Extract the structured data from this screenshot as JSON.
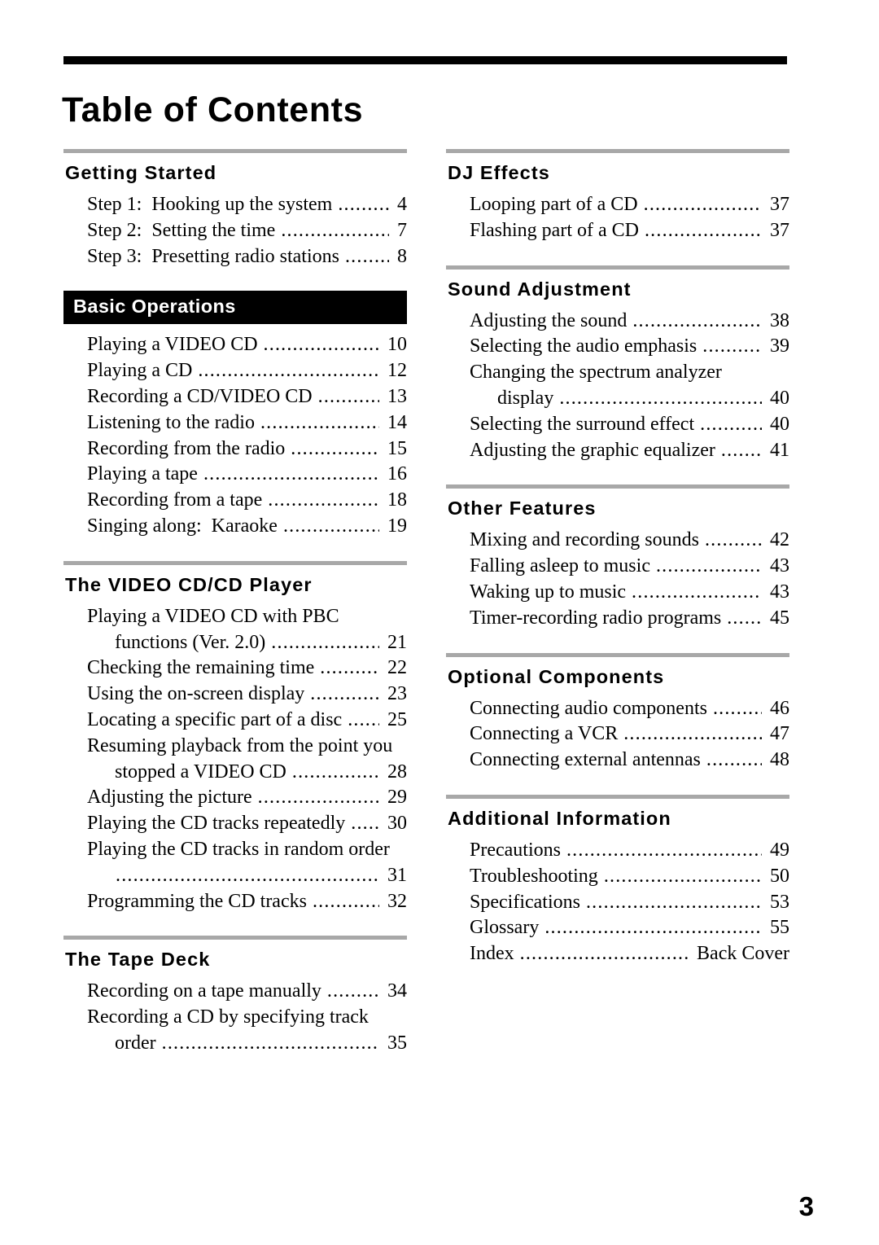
{
  "document": {
    "title": "Table of Contents",
    "folio": "3"
  },
  "columns": [
    {
      "name": "left",
      "sections": [
        {
          "heading": "Getting Started",
          "style": "rule",
          "entries": [
            {
              "lines": [
                "Step 1:  Hooking up the system"
              ],
              "page": "4"
            },
            {
              "lines": [
                "Step 2:  Setting the time"
              ],
              "page": "7"
            },
            {
              "lines": [
                "Step 3:  Presetting radio stations"
              ],
              "page": "8"
            }
          ]
        },
        {
          "heading": "Basic Operations",
          "style": "banner",
          "entries": [
            {
              "lines": [
                "Playing a VIDEO CD"
              ],
              "page": "10"
            },
            {
              "lines": [
                "Playing a CD"
              ],
              "page": "12"
            },
            {
              "lines": [
                "Recording a CD/VIDEO CD"
              ],
              "page": "13"
            },
            {
              "lines": [
                "Listening to the radio"
              ],
              "page": "14"
            },
            {
              "lines": [
                "Recording from the radio"
              ],
              "page": "15"
            },
            {
              "lines": [
                "Playing a tape"
              ],
              "page": "16"
            },
            {
              "lines": [
                "Recording from a tape"
              ],
              "page": "18"
            },
            {
              "lines": [
                "Singing along:  Karaoke"
              ],
              "page": "19"
            }
          ]
        },
        {
          "heading": "The VIDEO CD/CD Player",
          "style": "rule",
          "entries": [
            {
              "lines": [
                "Playing a VIDEO CD with PBC",
                "functions (Ver. 2.0)"
              ],
              "page": "21"
            },
            {
              "lines": [
                "Checking the remaining time"
              ],
              "page": "22"
            },
            {
              "lines": [
                "Using the on-screen display"
              ],
              "page": "23"
            },
            {
              "lines": [
                "Locating a specific part of a disc"
              ],
              "page": "25"
            },
            {
              "lines": [
                "Resuming playback from the point you",
                "stopped a VIDEO CD"
              ],
              "page": "28"
            },
            {
              "lines": [
                "Adjusting the picture"
              ],
              "page": "29"
            },
            {
              "lines": [
                "Playing the CD tracks repeatedly"
              ],
              "page": "30"
            },
            {
              "lines": [
                "Playing the CD tracks in random order",
                ""
              ],
              "page": "31"
            },
            {
              "lines": [
                "Programming the CD tracks"
              ],
              "page": "32"
            }
          ]
        },
        {
          "heading": "The Tape Deck",
          "style": "rule",
          "entries": [
            {
              "lines": [
                "Recording on a tape manually"
              ],
              "page": "34"
            },
            {
              "lines": [
                "Recording a CD by specifying track",
                "order"
              ],
              "page": "35"
            }
          ]
        }
      ]
    },
    {
      "name": "right",
      "sections": [
        {
          "heading": "DJ Effects",
          "style": "rule",
          "entries": [
            {
              "lines": [
                "Looping part of a CD"
              ],
              "page": "37"
            },
            {
              "lines": [
                "Flashing part of a CD"
              ],
              "page": "37"
            }
          ]
        },
        {
          "heading": "Sound Adjustment",
          "style": "rule",
          "entries": [
            {
              "lines": [
                "Adjusting the sound"
              ],
              "page": "38"
            },
            {
              "lines": [
                "Selecting the audio emphasis"
              ],
              "page": "39"
            },
            {
              "lines": [
                "Changing the spectrum analyzer",
                "display"
              ],
              "page": "40"
            },
            {
              "lines": [
                "Selecting the surround effect"
              ],
              "page": "40"
            },
            {
              "lines": [
                "Adjusting the graphic equalizer"
              ],
              "page": "41"
            }
          ]
        },
        {
          "heading": "Other Features",
          "style": "rule",
          "entries": [
            {
              "lines": [
                "Mixing and recording sounds"
              ],
              "page": "42"
            },
            {
              "lines": [
                "Falling asleep to music"
              ],
              "page": "43"
            },
            {
              "lines": [
                "Waking up to music"
              ],
              "page": "43"
            },
            {
              "lines": [
                "Timer-recording radio programs"
              ],
              "page": "45"
            }
          ]
        },
        {
          "heading": "Optional Components",
          "style": "rule",
          "entries": [
            {
              "lines": [
                "Connecting audio components"
              ],
              "page": "46"
            },
            {
              "lines": [
                "Connecting a VCR"
              ],
              "page": "47"
            },
            {
              "lines": [
                "Connecting external antennas"
              ],
              "page": "48"
            }
          ]
        },
        {
          "heading": "Additional Information",
          "style": "rule",
          "entries": [
            {
              "lines": [
                "Precautions"
              ],
              "page": "49"
            },
            {
              "lines": [
                "Troubleshooting"
              ],
              "page": "50"
            },
            {
              "lines": [
                "Specifications"
              ],
              "page": "53"
            },
            {
              "lines": [
                "Glossary"
              ],
              "page": "55"
            },
            {
              "lines": [
                "Index"
              ],
              "page": "Back Cover"
            }
          ]
        }
      ]
    }
  ]
}
